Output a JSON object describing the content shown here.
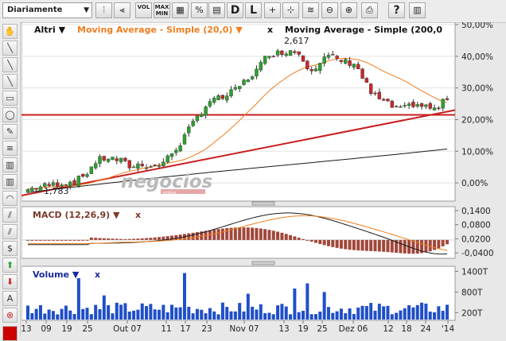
{
  "toolbar": {
    "period": "Diariamente",
    "buttons": [
      {
        "name": "candle-icon",
        "glyph": "⫶"
      },
      {
        "name": "ohlc-icon",
        "glyph": "⫷"
      },
      {
        "name": "vol-button",
        "glyph": "VOL"
      },
      {
        "name": "maxmin-button",
        "glyph": "MAX MIN"
      },
      {
        "name": "grid-icon",
        "glyph": "▦"
      },
      {
        "name": "percent-icon",
        "glyph": "%"
      },
      {
        "name": "table-icon",
        "glyph": "▤"
      },
      {
        "name": "daily-button",
        "glyph": "D"
      },
      {
        "name": "log-button",
        "glyph": "L"
      },
      {
        "name": "crosshair-icon",
        "glyph": "+"
      },
      {
        "name": "cursor-icon",
        "glyph": "⊹"
      },
      {
        "name": "trend-icon",
        "glyph": "≋"
      },
      {
        "name": "zoom-out-icon",
        "glyph": "⊖"
      },
      {
        "name": "zoom-in-icon",
        "glyph": "⊕"
      },
      {
        "name": "print-icon",
        "glyph": "⎙"
      },
      {
        "name": "help-icon",
        "glyph": "?"
      },
      {
        "name": "settings-icon",
        "glyph": "▥"
      }
    ]
  },
  "sidebar": {
    "tools": [
      {
        "name": "pan-hand-icon",
        "glyph": "✋"
      },
      {
        "name": "line-tool-icon",
        "glyph": "╲"
      },
      {
        "name": "ray-tool-icon",
        "glyph": "╲"
      },
      {
        "name": "extended-line-icon",
        "glyph": "╲"
      },
      {
        "name": "rectangle-tool-icon",
        "glyph": "▭"
      },
      {
        "name": "circle-tool-icon",
        "glyph": "◯"
      },
      {
        "name": "pencil-tool-icon",
        "glyph": "✎"
      },
      {
        "name": "fibonacci-tool-icon",
        "glyph": "≡"
      },
      {
        "name": "fib-fan-icon",
        "glyph": "▥"
      },
      {
        "name": "channel-tool-icon",
        "glyph": "▥"
      },
      {
        "name": "arc-tool-icon",
        "glyph": "◠"
      },
      {
        "name": "parallel-lines-icon",
        "glyph": "⫽"
      },
      {
        "name": "regression-tool-icon",
        "glyph": "⫽"
      },
      {
        "name": "dollar-tool-icon",
        "glyph": "$"
      },
      {
        "name": "arrow-up-icon",
        "glyph": "⬆"
      },
      {
        "name": "arrow-down-icon",
        "glyph": "⬇"
      },
      {
        "name": "text-tool-icon",
        "glyph": "A"
      },
      {
        "name": "delete-icon",
        "glyph": "⊗"
      }
    ],
    "color": "#cc0000"
  },
  "main": {
    "symbol": "Altri",
    "ma20_label": "Moving Average - Simple (20,0)",
    "ma200_label": "Moving Average - Simple (200,0",
    "close_label": "x",
    "high_label": "2,617",
    "low_label": "1,783",
    "watermark": "negocios",
    "watermark_sub": "online",
    "y_ticks": [
      "50,00%",
      "40,00%",
      "30,00%",
      "20,00%",
      "10,00%",
      "0,00%"
    ]
  },
  "macd": {
    "label": "MACD (12,26,9)",
    "close_label": "x",
    "y_ticks": [
      "0,1400",
      "0,0800",
      "0,0200",
      "-0,0400"
    ]
  },
  "volume": {
    "label": "Volume",
    "close_label": "x",
    "y_ticks": [
      "1400T",
      "800T",
      "200T"
    ]
  },
  "xaxis": {
    "labels": [
      "13",
      "09",
      "19",
      "25",
      "Out 07",
      "11",
      "17",
      "23",
      "Nov 07",
      "13",
      "19",
      "25",
      "Dez 06",
      "12",
      "18",
      "24",
      "'14"
    ]
  },
  "colors": {
    "up": "#2ea02e",
    "down": "#c8282a",
    "ma20": "#f07d1e",
    "ma200": "#1a1a1a",
    "trend": "#c81e1e",
    "macd_hist": "#a0473a",
    "vol": "#1f4fc8"
  },
  "chart_data": {
    "type": "candlestick",
    "ylim_pct": [
      -5,
      50
    ],
    "macd_ylim": [
      -0.06,
      0.15
    ],
    "volume_ylim_T": [
      0,
      1500
    ]
  }
}
